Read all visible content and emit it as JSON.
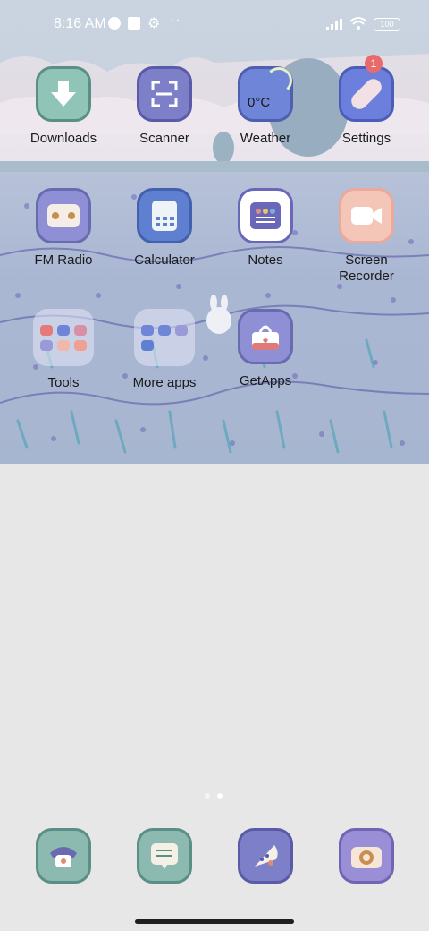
{
  "status": {
    "time": "8:16 AM",
    "battery": "100",
    "icons": [
      "pie-chart-icon",
      "square-notification-icon",
      "gear-icon",
      "more-icon",
      "signal-icon",
      "wifi-icon",
      "battery-icon"
    ]
  },
  "apps": [
    {
      "label": "Downloads",
      "icon": "download-arrow-icon"
    },
    {
      "label": "Scanner",
      "icon": "scan-frame-icon"
    },
    {
      "label": "Weather",
      "icon": "weather-icon",
      "temp": "0°C"
    },
    {
      "label": "Settings",
      "icon": "bandage-settings-icon",
      "badge": "1"
    },
    {
      "label": "FM Radio",
      "icon": "radio-icon"
    },
    {
      "label": "Calculator",
      "icon": "calculator-icon"
    },
    {
      "label": "Notes",
      "icon": "notes-icon"
    },
    {
      "label": "Screen\nRecorder",
      "icon": "video-camera-icon"
    },
    {
      "label": "Tools",
      "icon": "folder-icon"
    },
    {
      "label": "More apps",
      "icon": "folder-icon"
    },
    {
      "label": "GetApps",
      "icon": "shopping-bag-icon"
    }
  ],
  "dock": [
    {
      "name": "phone-icon"
    },
    {
      "name": "messages-icon"
    },
    {
      "name": "browser-icon"
    },
    {
      "name": "camera-icon"
    }
  ],
  "pages": {
    "count": 2,
    "current": 2
  },
  "colors": {
    "sky": "#c9d4e0",
    "field": "#a7b6d0",
    "screen_bg": "#e7e7e8",
    "icon_purple": "#8f8fd6",
    "icon_teal": "#8cb9b0",
    "icon_blue": "#6f86d8",
    "badge_red": "#e86a6a"
  }
}
